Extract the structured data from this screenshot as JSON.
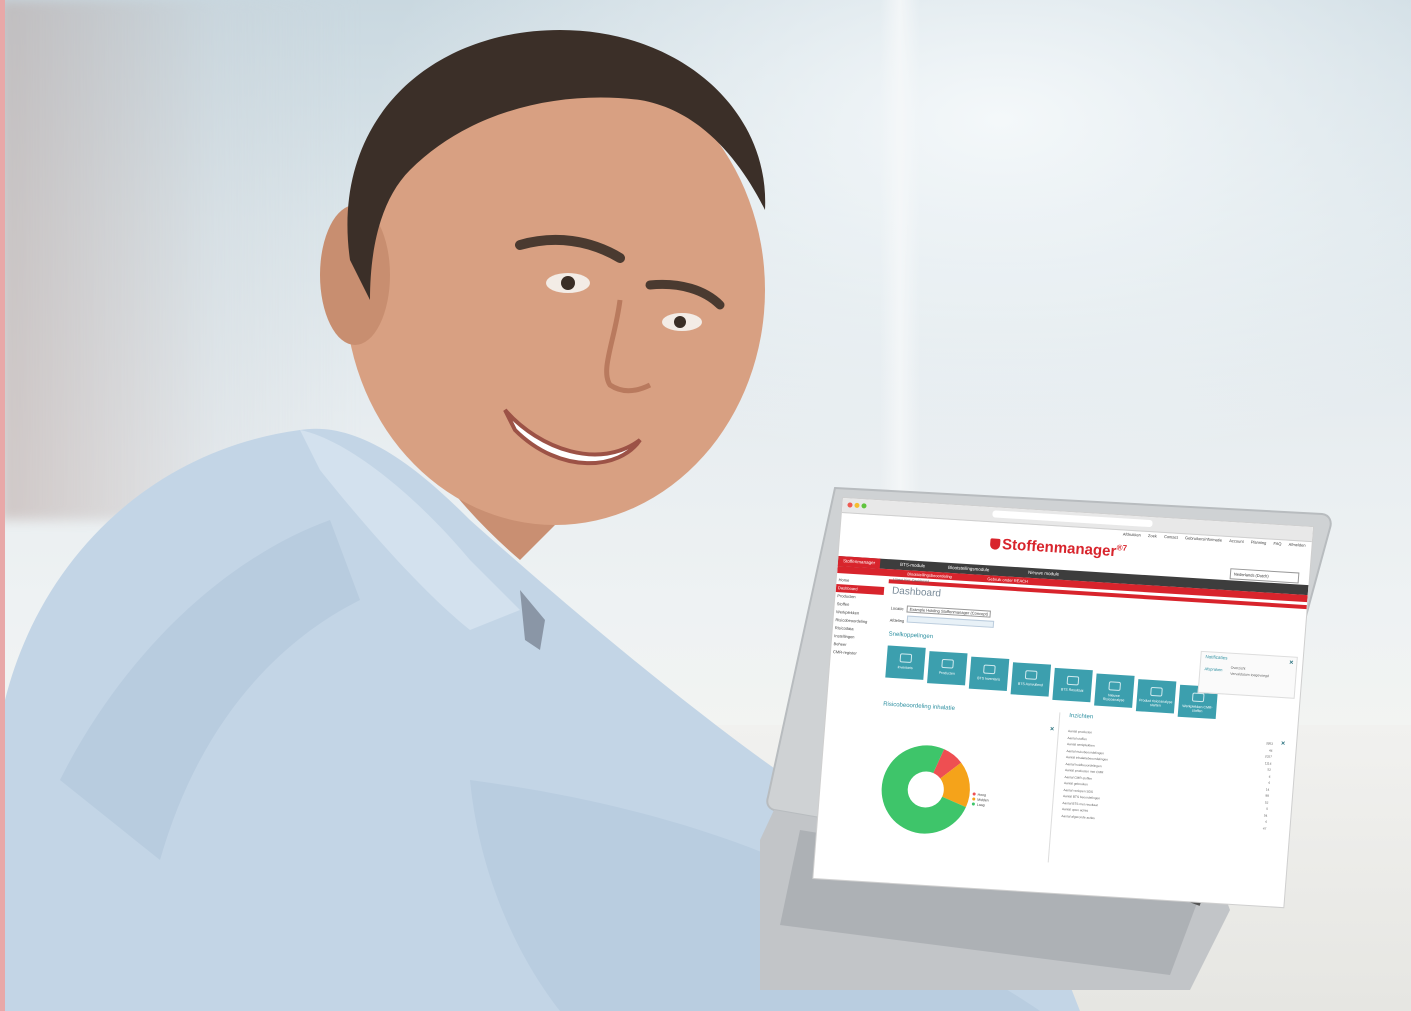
{
  "app": {
    "brand": "Stoffenmanager",
    "version": "7",
    "top_links": [
      "Afdrukken",
      "Zoek",
      "Contact",
      "Gebruikersinformatie",
      "Account",
      "Planning",
      "FAQ",
      "Afmelden"
    ],
    "language": "Nederlands (Dutch)",
    "nav": [
      "Stoffenmanager",
      "BTS-module",
      "Blootstellingsmodule",
      "Nieuwe module"
    ],
    "subnav": [
      "Blootstellingsbeoordeling",
      "Gebruik onder REACH"
    ],
    "breadcrumb": "U bent hier: Dashboard",
    "page_title": "Dashboard",
    "row1_label": "Locatie",
    "row1_value": "Example Holding Stoffenmanager (Concept)",
    "row2_label": "Afdeling",
    "sidebar": [
      "Home",
      "Dashboard",
      "Producten",
      "Stoffen",
      "Werkplekken",
      "Risicobeoordeling",
      "Risicodata",
      "Instellingen",
      "Beheer",
      "CMR-register"
    ]
  },
  "shortcuts": {
    "title": "Snelkoppelingen",
    "tiles": [
      "Inventaris",
      "Producten",
      "BTS Inventaris",
      "BTS Aanvullend",
      "BTS Resultaat",
      "Nieuwe Risicoanalyse",
      "Product risicoanalyse starten",
      "Werkplekken CMR-stoffen"
    ]
  },
  "notifications": {
    "title": "Notificaties",
    "main": "Afspraken",
    "line1": "Overzicht",
    "line2": "Vervaldatum toegevoegd"
  },
  "risk": {
    "title": "Risicobeoordeling inhalatie",
    "legend": [
      "Hoog",
      "Midden",
      "Laag"
    ],
    "colors": [
      "#ee4f52",
      "#f5a31a",
      "#3ec56a"
    ]
  },
  "chart_data": {
    "type": "pie",
    "categories": [
      "Hoog",
      "Midden",
      "Laag"
    ],
    "values": [
      8,
      17,
      75
    ]
  },
  "insights": {
    "title": "Inzichten",
    "rows": [
      {
        "label": "Aantal producten",
        "value": "3953"
      },
      {
        "label": "Aantal stoffen",
        "value": "44"
      },
      {
        "label": "Aantal werkplekken",
        "value": "2027"
      },
      {
        "label": "Aantal risicobeoordelingen",
        "value": "1114"
      },
      {
        "label": "Aantal inhalatiebeoordelingen",
        "value": "52"
      },
      {
        "label": "Aantal huidbeoordelingen",
        "value": "4"
      },
      {
        "label": "Aantal producten met CMR",
        "value": "4"
      },
      {
        "label": "Aantal CMR-stoffen",
        "value": "14"
      },
      {
        "label": "Aantal gebruiken",
        "value": "88"
      },
      {
        "label": "Aantal verlopen SDS",
        "value": "52"
      },
      {
        "label": "Aantal BTS beoordelingen",
        "value": "0"
      },
      {
        "label": "Aantal BTS met resultaat",
        "value": "54"
      },
      {
        "label": "Aantal open acties",
        "value": "4"
      },
      {
        "label": "Aantal afgeronde acties",
        "value": "47"
      }
    ]
  }
}
